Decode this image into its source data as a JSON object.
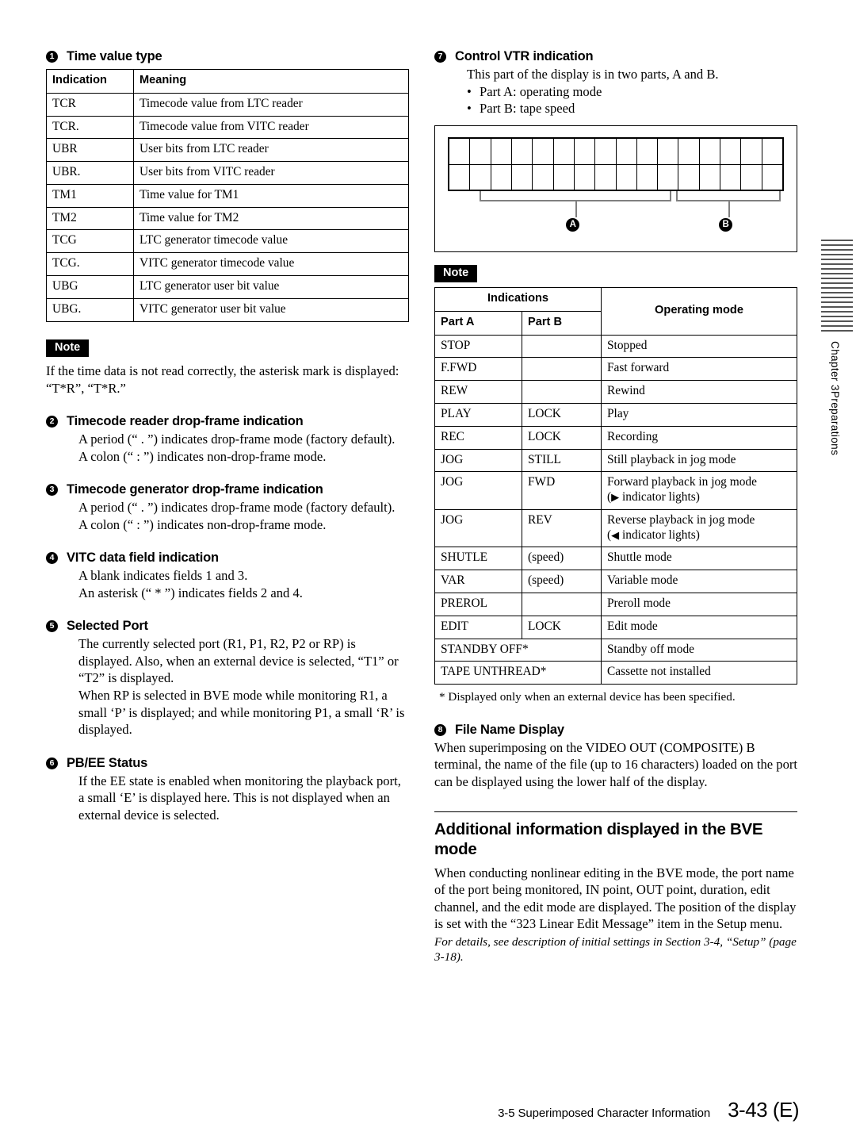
{
  "left_column": {
    "item1": {
      "number": "1",
      "title": "Time value type",
      "table": {
        "headers": [
          "Indication",
          "Meaning"
        ],
        "rows": [
          [
            "TCR",
            "Timecode value from LTC reader"
          ],
          [
            "TCR.",
            "Timecode value from VITC reader"
          ],
          [
            "UBR",
            "User bits from LTC reader"
          ],
          [
            "UBR.",
            "User bits from VITC reader"
          ],
          [
            "TM1",
            "Time value for TM1"
          ],
          [
            "TM2",
            "Time value for TM2"
          ],
          [
            "TCG",
            "LTC generator timecode value"
          ],
          [
            "TCG.",
            "VITC generator timecode value"
          ],
          [
            "UBG",
            "LTC generator user bit value"
          ],
          [
            "UBG.",
            "VITC generator user bit value"
          ]
        ]
      }
    },
    "note": {
      "badge": "Note",
      "text": "If the time data is not read correctly, the asterisk mark is displayed: “T*R”, “T*R.”"
    },
    "item2": {
      "number": "2",
      "title": "Timecode reader drop-frame indication",
      "line1": "A period (“ . ”) indicates drop-frame mode (factory default).",
      "line2": "A colon (“ : ”) indicates non-drop-frame mode."
    },
    "item3": {
      "number": "3",
      "title": "Timecode generator drop-frame indication",
      "line1": "A period (“ . ”) indicates drop-frame mode (factory default).",
      "line2": "A colon (“ : ”) indicates non-drop-frame mode."
    },
    "item4": {
      "number": "4",
      "title": "VITC data field indication",
      "line1": "A blank indicates fields 1 and 3.",
      "line2": "An asterisk (“ * ”) indicates fields 2 and 4."
    },
    "item5": {
      "number": "5",
      "title": "Selected Port",
      "line1": "The currently selected port (R1, P1, R2, P2 or RP) is displayed. Also, when an external device is selected, “T1” or “T2” is displayed.",
      "line2": "When RP is selected in BVE mode while monitoring R1, a small ‘P’ is displayed; and while monitoring P1, a small ‘R’ is displayed."
    },
    "item6": {
      "number": "6",
      "title": "PB/EE Status",
      "line1": "If the EE state is enabled when monitoring the playback port, a small ‘E’ is displayed here. This is not displayed when an external device is selected."
    }
  },
  "right_column": {
    "item7": {
      "number": "7",
      "title": "Control VTR indication",
      "intro": "This part of the display is in two parts, A and B.",
      "bullets": [
        "Part A: operating mode",
        "Part B: tape speed"
      ],
      "diagram": {
        "columns": 16,
        "rows": 2,
        "label_a": "A",
        "label_b": "B"
      }
    },
    "note": {
      "badge": "Note"
    },
    "opmode_table": {
      "header_group": "Indications",
      "header_a": "Part A",
      "header_b": "Part B",
      "header_mode": "Operating mode",
      "rows": [
        {
          "a": "STOP",
          "b": "",
          "mode": "Stopped"
        },
        {
          "a": "F.FWD",
          "b": "",
          "mode": "Fast forward"
        },
        {
          "a": "REW",
          "b": "",
          "mode": "Rewind"
        },
        {
          "a": "PLAY",
          "b": "LOCK",
          "mode": "Play"
        },
        {
          "a": "REC",
          "b": "LOCK",
          "mode": "Recording"
        },
        {
          "a": "JOG",
          "b": "STILL",
          "mode": "Still playback in jog mode"
        },
        {
          "a": "JOG",
          "b": "FWD",
          "mode": "Forward playback in jog mode",
          "mode2_pre": "(",
          "mode2_icon": "▶",
          "mode2_post": " indicator lights)"
        },
        {
          "a": "JOG",
          "b": "REV",
          "mode": "Reverse playback in jog mode",
          "mode2_pre": "(",
          "mode2_icon": "◀",
          "mode2_post": " indicator lights)"
        },
        {
          "a": "SHUTLE",
          "b": "(speed)",
          "mode": "Shuttle mode"
        },
        {
          "a": "VAR",
          "b": "(speed)",
          "mode": "Variable mode"
        },
        {
          "a": "PREROL",
          "b": "",
          "mode": "Preroll mode"
        },
        {
          "a": "EDIT",
          "b": "LOCK",
          "mode": "Edit mode"
        },
        {
          "a": "STANDBY OFF*",
          "span": true,
          "mode": "Standby off mode"
        },
        {
          "a": "TAPE UNTHREAD*",
          "span": true,
          "mode": "Cassette not installed"
        }
      ],
      "footnote": "*  Displayed only when an external device has been specified."
    },
    "item8": {
      "number": "8",
      "title": "File Name Display",
      "body": "When superimposing on the VIDEO OUT (COMPOSITE) B terminal, the name of the file (up to 16 characters) loaded on the port can be displayed using the lower half of the display."
    },
    "section": {
      "title": "Additional information displayed in the BVE mode",
      "body": "When conducting nonlinear editing in the BVE mode, the port name of the port being monitored, IN point, OUT point, duration, edit channel, and the edit mode are displayed. The position of the display is set with the “323 Linear Edit Message” item in the Setup menu.",
      "reference": "For details, see description of initial settings in Section 3-4, “Setup” (page 3-18)."
    }
  },
  "margin_tab": {
    "chapter": "Chapter 3",
    "part": "Preparations",
    "line_count": 20
  },
  "footer": {
    "section_label": "3-5  Superimposed Character Information",
    "page_number": "3-43 (E)"
  }
}
